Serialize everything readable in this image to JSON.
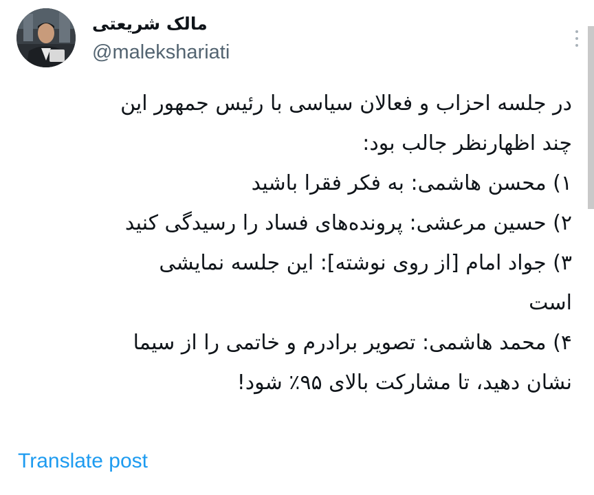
{
  "author": {
    "display_name": "مالک شریعتی",
    "handle": "@malekshariati",
    "avatar": "avatar-photo"
  },
  "tweet": {
    "lines": [
      "در جلسه احزاب و فعالان سیاسی با رئیس جمهور این",
      "چند اظهارنظر جالب بود:",
      "۱) محسن هاشمی: به فکر فقرا باشید",
      "۲) حسین مرعشی: پرونده‌های فساد را رسیدگی کنید",
      "۳) جواد امام [از روی نوشته]: این جلسه نمایشی",
      "است",
      "۴) محمد هاشمی: تصویر برادرم و خاتمی را از سیما",
      "نشان دهید، تا مشارکت بالای ۹۵٪ شود!"
    ]
  },
  "actions": {
    "translate_label": "Translate post",
    "more_icon": "more-vertical-icon"
  },
  "colors": {
    "text": "#0f1419",
    "secondary": "#536471",
    "link": "#1d9bf0"
  }
}
